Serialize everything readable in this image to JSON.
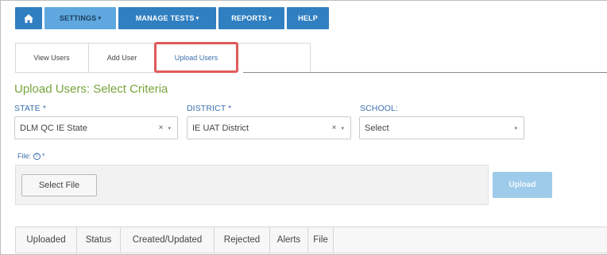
{
  "nav": {
    "home_icon": "home-icon",
    "settings": "SETTINGS",
    "manage_tests": "MANAGE TESTS",
    "reports": "REPORTS",
    "help": "HELP",
    "caret": "▾",
    "active_color": "#5ea8df",
    "color": "#2f7fc1"
  },
  "tabs": {
    "view_users": "View Users",
    "add_user": "Add User",
    "upload_users": "Upload Users",
    "highlight_color": "#e05a5a"
  },
  "title": "Upload Users: Select Criteria",
  "criteria": {
    "state_label": "STATE",
    "state_value": "DLM QC IE State",
    "district_label": "DISTRICT",
    "district_value": "IE UAT District",
    "school_label": "SCHOOL:",
    "school_value": "Select",
    "required_mark": "*",
    "clear": "×",
    "arrow": "▾"
  },
  "file": {
    "label": "File:",
    "help_icon": "?",
    "required_mark": "*",
    "select_button": "Select File",
    "upload_button": "Upload"
  },
  "table": {
    "columns": [
      "Uploaded",
      "Status",
      "Created/Updated",
      "Rejected",
      "Alerts",
      "File"
    ]
  }
}
